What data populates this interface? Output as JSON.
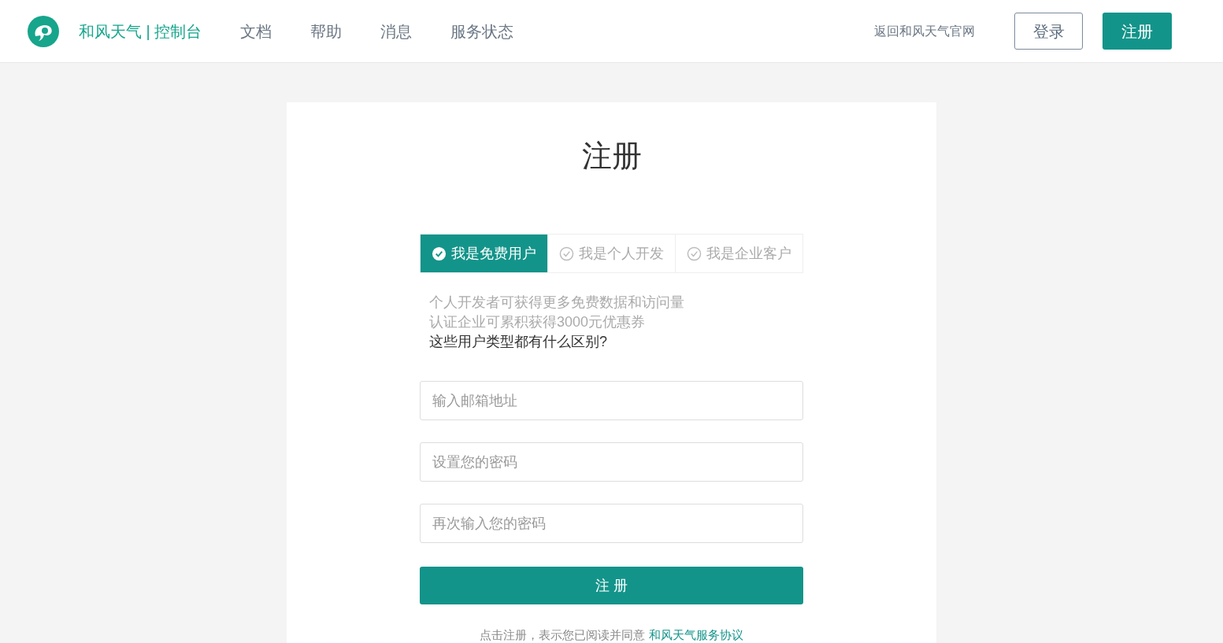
{
  "header": {
    "brand": "和风天气 | 控制台",
    "nav": [
      "文档",
      "帮助",
      "消息",
      "服务状态"
    ],
    "back_link": "返回和风天气官网",
    "login_button": "登录",
    "register_button": "注册"
  },
  "form": {
    "title": "注册",
    "tabs": [
      {
        "label": "我是免费用户",
        "selected": true
      },
      {
        "label": "我是个人开发",
        "selected": false
      },
      {
        "label": "我是企业客户",
        "selected": false
      }
    ],
    "info": [
      {
        "kind": "note",
        "text": "个人开发者可获得更多免费数据和访问量"
      },
      {
        "kind": "note",
        "text": "认证企业可累积获得3000元优惠券"
      },
      {
        "kind": "link",
        "text": "这些用户类型都有什么区别?"
      }
    ],
    "fields": [
      {
        "placeholder": "输入邮箱地址"
      },
      {
        "placeholder": "设置您的密码"
      },
      {
        "placeholder": "再次输入您的密码"
      }
    ],
    "submit": "注 册",
    "agreement": {
      "text": "点击注册，表示您已阅读并同意",
      "link": "和风天气服务协议"
    }
  }
}
